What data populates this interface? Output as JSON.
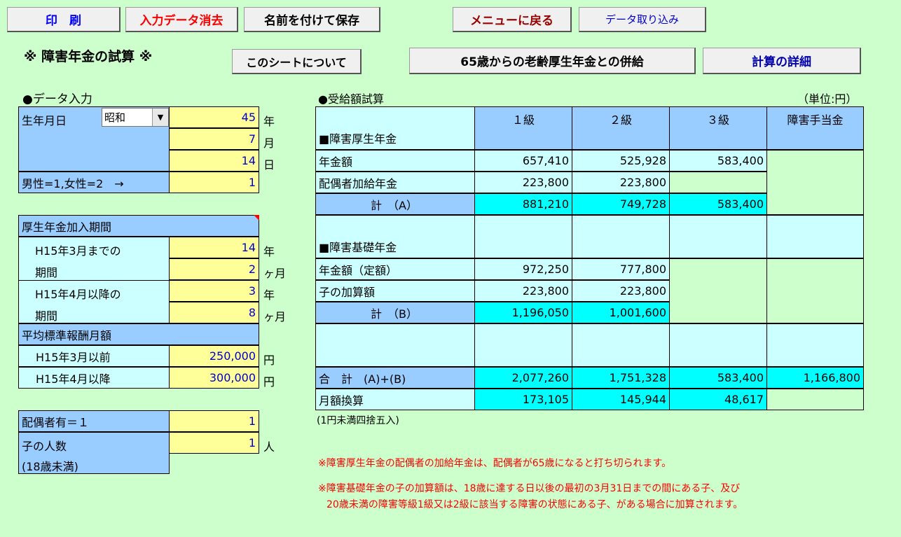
{
  "toolbar": {
    "print": "印　刷",
    "clear": "入力データ消去",
    "save": "名前を付けて保存",
    "menu": "メニューに戻る",
    "import": "データ取り込み"
  },
  "title": "※ 障害年金の試算 ※",
  "buttons2": {
    "about": "このシートについて",
    "combine": "65歳からの老齢厚生年金との併給",
    "detail": "計算の詳細"
  },
  "input": {
    "header": "●データ入力",
    "birth_label": "生年月日",
    "era": "昭和",
    "year": "45",
    "year_unit": "年",
    "month": "7",
    "month_unit": "月",
    "day": "14",
    "day_unit": "日",
    "gender_label": "男性=1,女性=2　→",
    "gender": "1",
    "period_header": "厚生年金加入期間",
    "h15_before_1": "H15年3月までの",
    "h15_before_2": "期間",
    "h15_before_years": "14",
    "years_unit": "年",
    "h15_before_months": "2",
    "months_unit": "ヶ月",
    "h15_after_1": "H15年4月以降の",
    "h15_after_2": "期間",
    "h15_after_years": "3",
    "years_unit2": "年",
    "h15_after_months": "8",
    "months_unit2": "ヶ月",
    "avg_header": "平均標準報酬月額",
    "avg_before_label": "H15年3月以前",
    "avg_before": "250,000",
    "yen1": "円",
    "avg_after_label": "H15年4月以降",
    "avg_after": "300,000",
    "yen2": "円",
    "spouse_label": "配偶者有＝１",
    "spouse": "1",
    "children_label": "子の人数",
    "children": "1",
    "children_unit": "人",
    "children_note": "(18歳未満)"
  },
  "result": {
    "header": "●受給額試算",
    "unit": "（単位:円）",
    "cols": [
      "１級",
      "２級",
      "３級",
      "障害手当金"
    ],
    "kosei_header": "■障害厚生年金",
    "kosei_amount_label": "年金額",
    "kosei_amount": [
      "657,410",
      "525,928",
      "583,400"
    ],
    "spouse_add_label": "配偶者加給年金",
    "spouse_add": [
      "223,800",
      "223,800"
    ],
    "sum_a_label": "計　（A）",
    "sum_a": [
      "881,210",
      "749,728",
      "583,400"
    ],
    "kiso_header": "■障害基礎年金",
    "kiso_amount_label": "年金額（定額）",
    "kiso_amount": [
      "972,250",
      "777,800"
    ],
    "child_add_label": "子の加算額",
    "child_add": [
      "223,800",
      "223,800"
    ],
    "sum_b_label": "計　（B）",
    "sum_b": [
      "1,196,050",
      "1,001,600"
    ],
    "total_label": "合　計　(A)+(B)",
    "total": [
      "2,077,260",
      "1,751,328",
      "583,400",
      "1,166,800"
    ],
    "monthly_label": "月額換算",
    "monthly": [
      "173,105",
      "145,944",
      "48,617"
    ],
    "rounding_note": "(1円未満四捨五入)"
  },
  "notes": {
    "note1": "※障害厚生年金の配偶者の加給年金は、配偶者が65歳になると打ち切られます。",
    "note2a": "※障害基礎年金の子の加算額は、18歳に達する日以後の最初の3月31日までの間にある子、及び",
    "note2b": "20歳未満の障害等級1級又は2級に該当する障害の状態にある子、がある場合に加算されます。"
  }
}
